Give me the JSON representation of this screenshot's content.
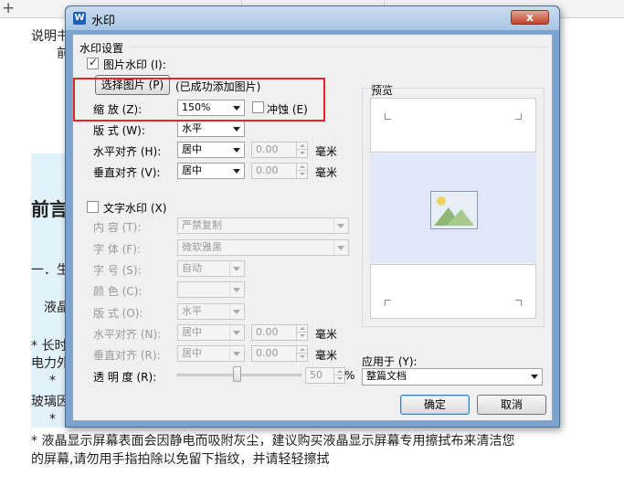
{
  "background_doc": {
    "lines": [
      "说明书",
      "前",
      "前言",
      "一．生",
      "液晶",
      "* 长时",
      "电力外",
      "* ",
      "玻璃因",
      "* ",
      "* 液晶显示屏幕表面会因静电而吸附灰尘，建议购买液晶显示屏幕专用擦拭布来清洁您",
      "的屏幕,请勿用手指拍除以免留下指纹，并请轻轻擦拭"
    ]
  },
  "dialog": {
    "title": "水印",
    "title_icon": "W",
    "close_label": "x",
    "section_title": "水印设置",
    "picture": {
      "checkbox_label": "图片水印 (I):",
      "checked": true,
      "select_button": "选择图片 (P)",
      "status": "(已成功添加图片)",
      "scale_label": "缩    放 (Z):",
      "scale_value": "150%",
      "washout_label": "冲蚀 (E)",
      "layout_label": "版    式 (W):",
      "layout_value": "水平",
      "halign_label": "水平对齐 (H):",
      "halign_value": "居中",
      "halign_offset": "0.00",
      "valign_label": "垂直对齐 (V):",
      "valign_value": "居中",
      "valign_offset": "0.00",
      "unit": "毫米"
    },
    "text": {
      "checkbox_label": "文字水印 (X)",
      "checked": false,
      "content_label": "内    容 (T):",
      "content_value": "严禁复制",
      "font_label": "字    体 (F):",
      "font_value": "微软雅黑",
      "size_label": "字    号 (S):",
      "size_value": "自动",
      "color_label": "颜    色 (C):",
      "layout_label": "版    式 (O):",
      "layout_value": "水平",
      "halign_label": "水平对齐 (N):",
      "halign_value": "居中",
      "halign_offset": "0.00",
      "valign_label": "垂直对齐 (R):",
      "valign_value": "居中",
      "valign_offset": "0.00",
      "unit": "毫米",
      "transparency_label": "透 明 度 (R):",
      "transparency_value": "50",
      "transparency_unit": "%"
    },
    "preview_label": "预览",
    "apply_label": "应用于 (Y):",
    "apply_value": "整篇文档",
    "ok_label": "确定",
    "cancel_label": "取消"
  },
  "colors": {
    "annotation_box": "#e3262b",
    "dialog_frame": "#7aa4cf",
    "preview_band": "#dfe7f8"
  }
}
